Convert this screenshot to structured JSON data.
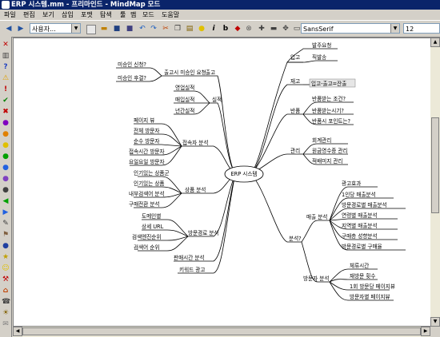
{
  "window": {
    "title": "ERP 시스템.mm - 프리마인드 - MindMap 모드"
  },
  "menu": {
    "items": [
      "파일",
      "편집",
      "보기",
      "삽입",
      "포맷",
      "탐색",
      "툴",
      "맵",
      "모드",
      "도움말"
    ]
  },
  "toolbar": {
    "zoom_value": "사용자...",
    "font_family": "SansSerif",
    "font_size": "12"
  },
  "colors": {
    "title_bar": "#0a246a",
    "canvas_bg": "#ffffff",
    "chrome": "#d4d0c8"
  },
  "mindmap": {
    "root": "ERP 시스템",
    "nodes": {
      "stock_out": "출고",
      "stock_out_q1": "미승인 신청?",
      "stock_out_q2": "미승인 후결?",
      "stock_out_approval": "출고시 미승인 요청",
      "stock": "재고",
      "sales_status": "영업실적",
      "purchase_status": "매입실적",
      "annual_status": "년간실적",
      "status": "실적",
      "visitor_analysis": "접속자 분석",
      "daily_view": "페이지 뷰",
      "total_visitors": "전체 방문자",
      "unique_visitors": "순수 방문자",
      "hourly_visitors": "접속시간 방문자",
      "daily_visitors": "요일요일 방문자",
      "product_analysis": "상품 분석",
      "popular_products": "인기있는 상품군",
      "popular_items": "인기있는 상품",
      "cart_analysis": "내부검색어 분석",
      "purchase_analysis": "구매전환 분석",
      "path_analysis": "방문경로 분석",
      "domain_ranking": "도메인별",
      "detail_url": "상세 URL",
      "search_engine": "검색엔진순위",
      "search_keyword": "검색어 순위",
      "sales_time": "판매시간 분석",
      "keyword_ad": "키워드 광고",
      "analysis": "분석?",
      "inbound": "입고",
      "order_request": "발주요청",
      "direct_order": "직발송",
      "inventory": "재고",
      "in_out_move": "입고-출고=잔출",
      "return": "반품",
      "return_condition": "반품받는 조건?",
      "return_when": "반품받는시기?",
      "return_point": "반품시 포인트는?",
      "management": "관리",
      "accounting": "회계관리",
      "cost_price": "원금영수증 관리",
      "purchase_mgmt": "적배미지 관리",
      "ad_effect": "광고효과",
      "roi": "ROI",
      "ad_analysis": "매출 분석",
      "ad_1day": "1인당 매출분석",
      "ad_visitor": "방문경로별 매출분석",
      "ad_age": "연령별 매출분석",
      "ad_region": "지역별 매출분석",
      "ad_purchase": "구매층 성향분석",
      "ad_path": "방문경로별 구매율",
      "visitor_behavior": "방문자 분석",
      "stay_time": "체류시간",
      "revisit": "재방문 횟수",
      "pages_per_visit": "1회 방문당 페이지뷰",
      "visitor_pageview": "방문자별 페이지뷰"
    }
  }
}
